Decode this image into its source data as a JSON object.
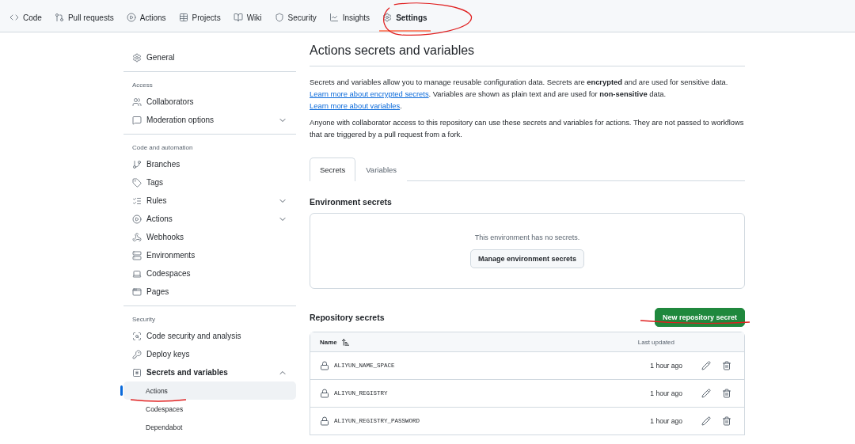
{
  "repo_nav": [
    {
      "label": "Code",
      "selected": false
    },
    {
      "label": "Pull requests",
      "selected": false
    },
    {
      "label": "Actions",
      "selected": false
    },
    {
      "label": "Projects",
      "selected": false
    },
    {
      "label": "Wiki",
      "selected": false
    },
    {
      "label": "Security",
      "selected": false
    },
    {
      "label": "Insights",
      "selected": false
    },
    {
      "label": "Settings",
      "selected": true
    }
  ],
  "sidebar": {
    "sections": [
      {
        "items": [
          {
            "label": "General",
            "kind": "link"
          }
        ]
      },
      {
        "heading": "Access",
        "items": [
          {
            "label": "Collaborators",
            "kind": "link"
          },
          {
            "label": "Moderation options",
            "kind": "group",
            "expanded": false
          }
        ]
      },
      {
        "heading": "Code and automation",
        "items": [
          {
            "label": "Branches",
            "kind": "link"
          },
          {
            "label": "Tags",
            "kind": "link"
          },
          {
            "label": "Rules",
            "kind": "group",
            "expanded": false
          },
          {
            "label": "Actions",
            "kind": "group",
            "expanded": false
          },
          {
            "label": "Webhooks",
            "kind": "link"
          },
          {
            "label": "Environments",
            "kind": "link"
          },
          {
            "label": "Codespaces",
            "kind": "link"
          },
          {
            "label": "Pages",
            "kind": "link"
          }
        ]
      },
      {
        "heading": "Security",
        "items": [
          {
            "label": "Code security and analysis",
            "kind": "link"
          },
          {
            "label": "Deploy keys",
            "kind": "link"
          },
          {
            "label": "Secrets and variables",
            "kind": "group",
            "expanded": true,
            "children": [
              {
                "label": "Actions",
                "selected": true
              },
              {
                "label": "Codespaces",
                "selected": false
              },
              {
                "label": "Dependabot",
                "selected": false
              }
            ]
          }
        ]
      }
    ]
  },
  "title": "Actions secrets and variables",
  "intro": [
    {
      "parts": [
        {
          "kind": "text",
          "text": "Secrets and variables allow you to manage reusable configuration data. Secrets are **encrypted** and are used for sensitive data. "
        },
        {
          "kind": "link",
          "text": "Learn more about encrypted secrets"
        },
        {
          "kind": "text",
          "text": ". Variables are shown as plain text and are used for **non-sensitive** data. "
        },
        {
          "kind": "link",
          "text": "Learn more about variables"
        },
        {
          "kind": "text",
          "text": "."
        }
      ]
    },
    {
      "parts": [
        {
          "kind": "text",
          "text": "Anyone with collaborator access to this repository can use these secrets and variables for actions. They are not passed to workflows that are triggered by a pull request from a fork."
        }
      ]
    }
  ],
  "tabs": [
    {
      "label": "Secrets",
      "selected": true
    },
    {
      "label": "Variables",
      "selected": false
    }
  ],
  "environment_secrets": {
    "heading": "Environment secrets",
    "empty_text": "This environment has no secrets.",
    "button": "Manage environment secrets"
  },
  "repository_secrets": {
    "heading": "Repository secrets",
    "button": "New repository secret",
    "columns": [
      "Name",
      "Last updated"
    ],
    "rows": [
      {
        "name": "ALIYUN_NAME_SPACE",
        "updated": "1 hour ago"
      },
      {
        "name": "ALIYUN_REGISTRY",
        "updated": "1 hour ago"
      },
      {
        "name": "ALIYUN_REGISTRY_PASSWORD",
        "updated": "1 hour ago"
      }
    ]
  }
}
